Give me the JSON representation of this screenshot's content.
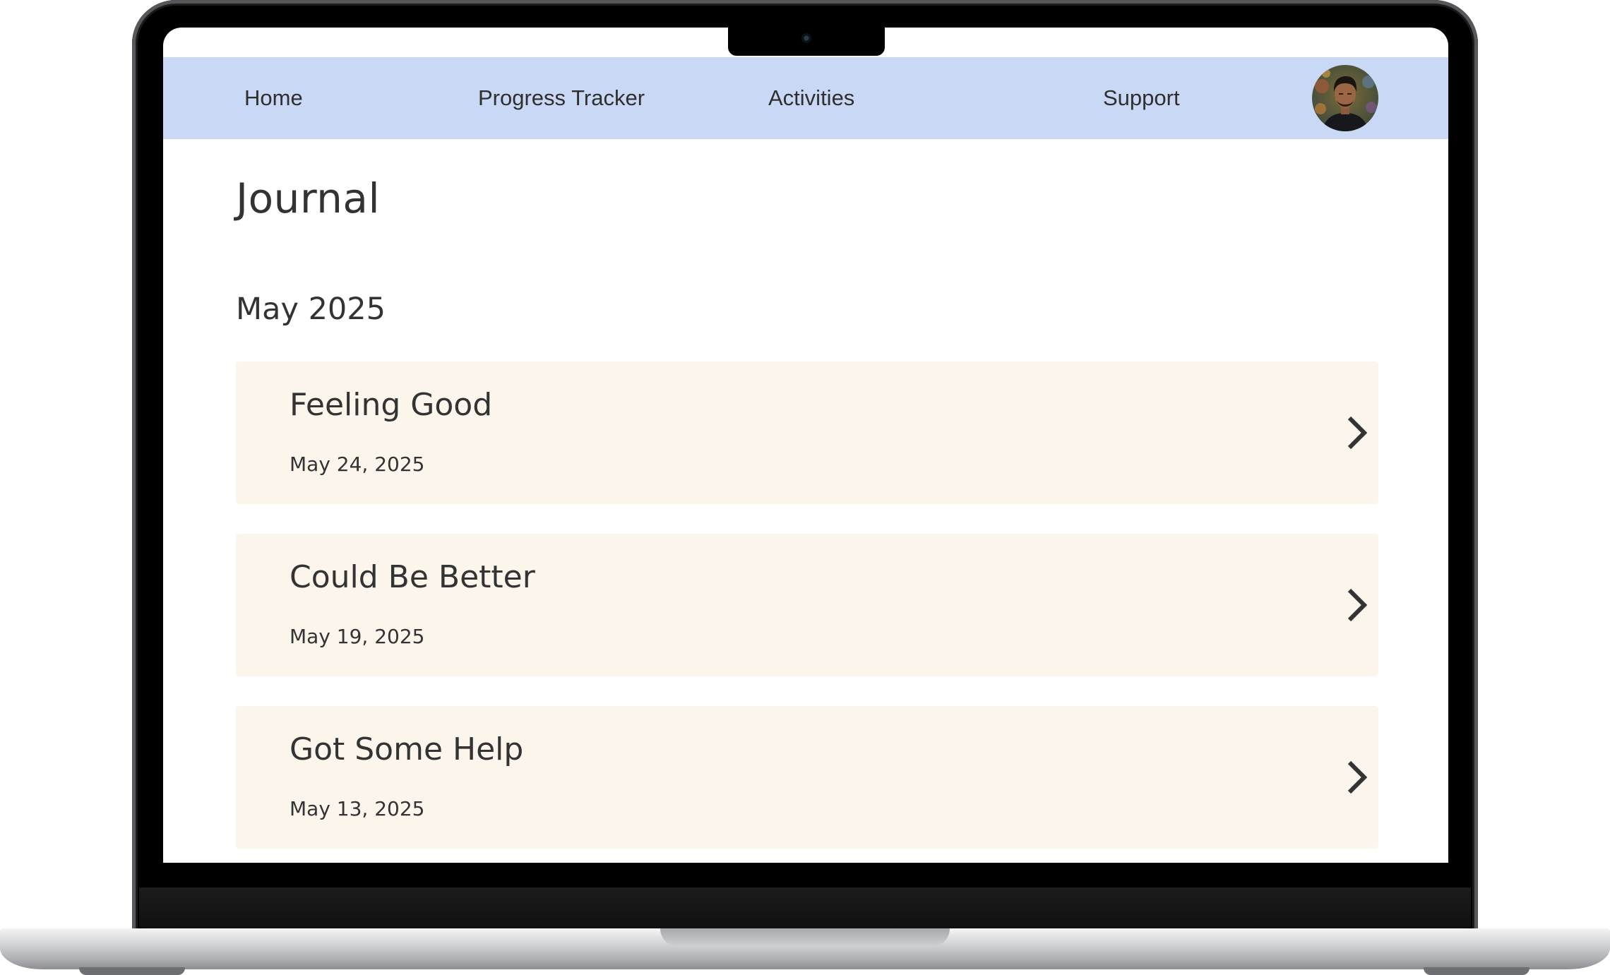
{
  "nav": {
    "items": [
      {
        "label": "Home"
      },
      {
        "label": "Progress Tracker"
      },
      {
        "label": "Activities"
      },
      {
        "label": "Support"
      }
    ],
    "avatar_icon": "user-avatar-photo"
  },
  "page": {
    "title": "Journal"
  },
  "journal": {
    "month": "May 2025",
    "entries": [
      {
        "title": "Feeling Good",
        "date": "May 24, 2025"
      },
      {
        "title": "Could Be Better",
        "date": "May 19, 2025"
      },
      {
        "title": "Got Some Help",
        "date": "May 13, 2025"
      }
    ],
    "chevron_icon": "chevron-right-icon"
  },
  "colors": {
    "nav_background": "#c9d8f4",
    "entry_background": "#fcf5ec",
    "text": "#333333"
  }
}
